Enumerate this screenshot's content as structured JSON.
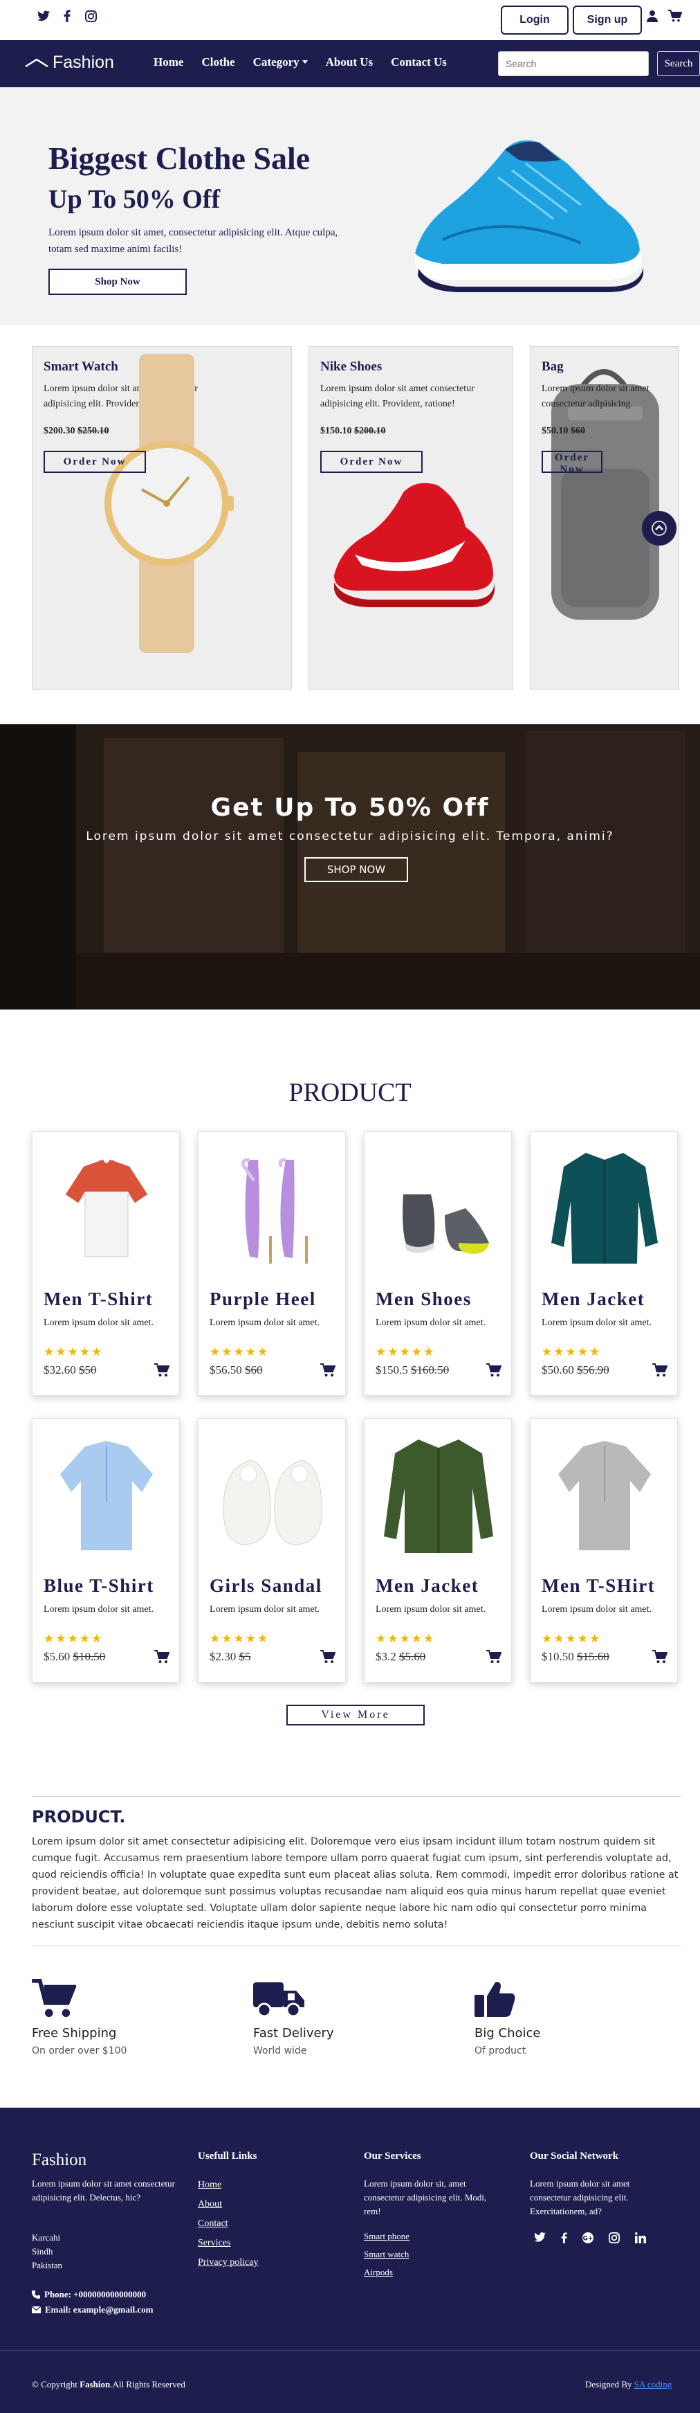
{
  "topbar": {
    "social_icons": [
      "twitter-icon",
      "facebook-icon",
      "instagram-icon"
    ],
    "login_label": "Login",
    "signup_label": "Sign up",
    "icons": [
      "user-icon",
      "cart-icon"
    ]
  },
  "nav": {
    "logo": "Fashion",
    "links": [
      "Home",
      "Clothe",
      "Category",
      "About Us",
      "Contact Us"
    ],
    "search_placeholder": "Search",
    "search_button": "Search"
  },
  "hero": {
    "title": "Biggest Clothe Sale",
    "subtitle": "Up To 50% Off",
    "text": "Lorem ipsum dolor sit amet, consectetur adipisicing elit. Atque culpa, totam sed maxime animi facilis!",
    "button": "Shop Now"
  },
  "featured": [
    {
      "title": "Smart Watch",
      "desc": "Lorem ipsum dolor sit amet consectetur adipisicing elit. Provident, ratione!",
      "price": "$200.30",
      "old_price": "$250.10",
      "button": "Order Now"
    },
    {
      "title": "Nike Shoes",
      "desc": "Lorem ipsum dolor sit amet consectetur adipisicing elit. Provident, ratione!",
      "price": "$150.10",
      "old_price": "$200.10",
      "button": "Order Now"
    },
    {
      "title": "Bag",
      "desc": "Lorem ipsum dolor sit amet consectetur adipisicing",
      "price": "$50.10",
      "old_price": "$60",
      "button": "Order Now"
    }
  ],
  "banner": {
    "title": "Get Up To 50% Off",
    "text": "Lorem ipsum dolor sit amet consectetur adipisicing elit. Tempora, animi?",
    "button": "SHOP NOW"
  },
  "products_section": {
    "title": "PRODUCT",
    "items": [
      {
        "name": "Men T-Shirt",
        "desc": "Lorem ipsum dolor sit amet.",
        "price": "$32.60",
        "old_price": "$50",
        "rating": 5
      },
      {
        "name": "Purple Heel",
        "desc": "Lorem ipsum dolor sit amet.",
        "price": "$56.50",
        "old_price": "$60",
        "rating": 5
      },
      {
        "name": "Men Shoes",
        "desc": "Lorem ipsum dolor sit amet.",
        "price": "$150.5",
        "old_price": "$160.50",
        "rating": 5
      },
      {
        "name": "Men Jacket",
        "desc": "Lorem ipsum dolor sit amet.",
        "price": "$50.60",
        "old_price": "$56.90",
        "rating": 5
      },
      {
        "name": "Blue T-Shirt",
        "desc": "Lorem ipsum dolor sit amet.",
        "price": "$5.60",
        "old_price": "$10.50",
        "rating": 5
      },
      {
        "name": "Girls Sandal",
        "desc": "Lorem ipsum dolor sit amet.",
        "price": "$2.30",
        "old_price": "$5",
        "rating": 5
      },
      {
        "name": "Men Jacket",
        "desc": "Lorem ipsum dolor sit amet.",
        "price": "$3.2",
        "old_price": "$5.60",
        "rating": 5
      },
      {
        "name": "Men T-SHirt",
        "desc": "Lorem ipsum dolor sit amet.",
        "price": "$10.50",
        "old_price": "$15.60",
        "rating": 5
      }
    ],
    "view_more": "View More"
  },
  "about": {
    "title": "PRODUCT.",
    "text": "Lorem ipsum dolor sit amet consectetur adipisicing elit. Doloremque vero eius ipsam incidunt illum totam nostrum quidem sit cumque fugit. Accusamus rem praesentium labore tempore ullam porro quaerat fugiat cum ipsum, sint perferendis voluptate ad, quod reiciendis officia! In voluptate quae expedita sunt eum placeat alias soluta. Rem commodi, impedit error doloribus ratione at provident beatae, aut doloremque sunt possimus voluptas recusandae nam aliquid eos quia minus harum repellat quae eveniet laborum dolore esse voluptate sed. Voluptate ullam dolor sapiente neque labore hic nam odio qui consectetur porro minima nesciunt suscipit vitae obcaecati reiciendis itaque ipsum unde, debitis nemo soluta!"
  },
  "features": [
    {
      "title": "Free Shipping",
      "sub": "On order over $100",
      "icon": "cart-icon"
    },
    {
      "title": "Fast Delivery",
      "sub": "World wide",
      "icon": "truck-icon"
    },
    {
      "title": "Big Choice",
      "sub": "Of product",
      "icon": "thumbs-up-icon"
    }
  ],
  "footer": {
    "brand": "Fashion",
    "brand_text": "Lorem ipsum dolor sit amet consectetur adipisicing elit. Delectus, hic?",
    "address": [
      "Karcahi",
      "Sindh",
      "Pakistan"
    ],
    "phone": "Phone: +000000000000000",
    "email": "Email: example@gmail.com",
    "links_title": "Usefull Links",
    "links": [
      "Home",
      "About",
      "Contact",
      "Services",
      "Privacy policay"
    ],
    "services_title": "Our Services",
    "services_text": "Lorem ipsum dolor sit, amet consectetur adipisicing elit. Modi, rem!",
    "services": [
      "Smart phone",
      "Smart watch",
      "Airpods"
    ],
    "social_title": "Our Social Network",
    "social_text": "Lorem ipsum dolor sit amet consectetur adipisicing elit. Exercitationem, ad?",
    "social_icons": [
      "twitter-icon",
      "facebook-icon",
      "google-plus-icon",
      "instagram-icon",
      "linkedin-icon"
    ],
    "copyright_prefix": "© Copyright",
    "copyright_brand": "Fashion",
    "copyright_suffix": ".All Rights Reserved",
    "designed_by": "Designed By",
    "designer": "SA coding"
  },
  "colors": {
    "primary": "#1d1e4e",
    "star": "#f5b400",
    "link": "#4a8cff"
  }
}
